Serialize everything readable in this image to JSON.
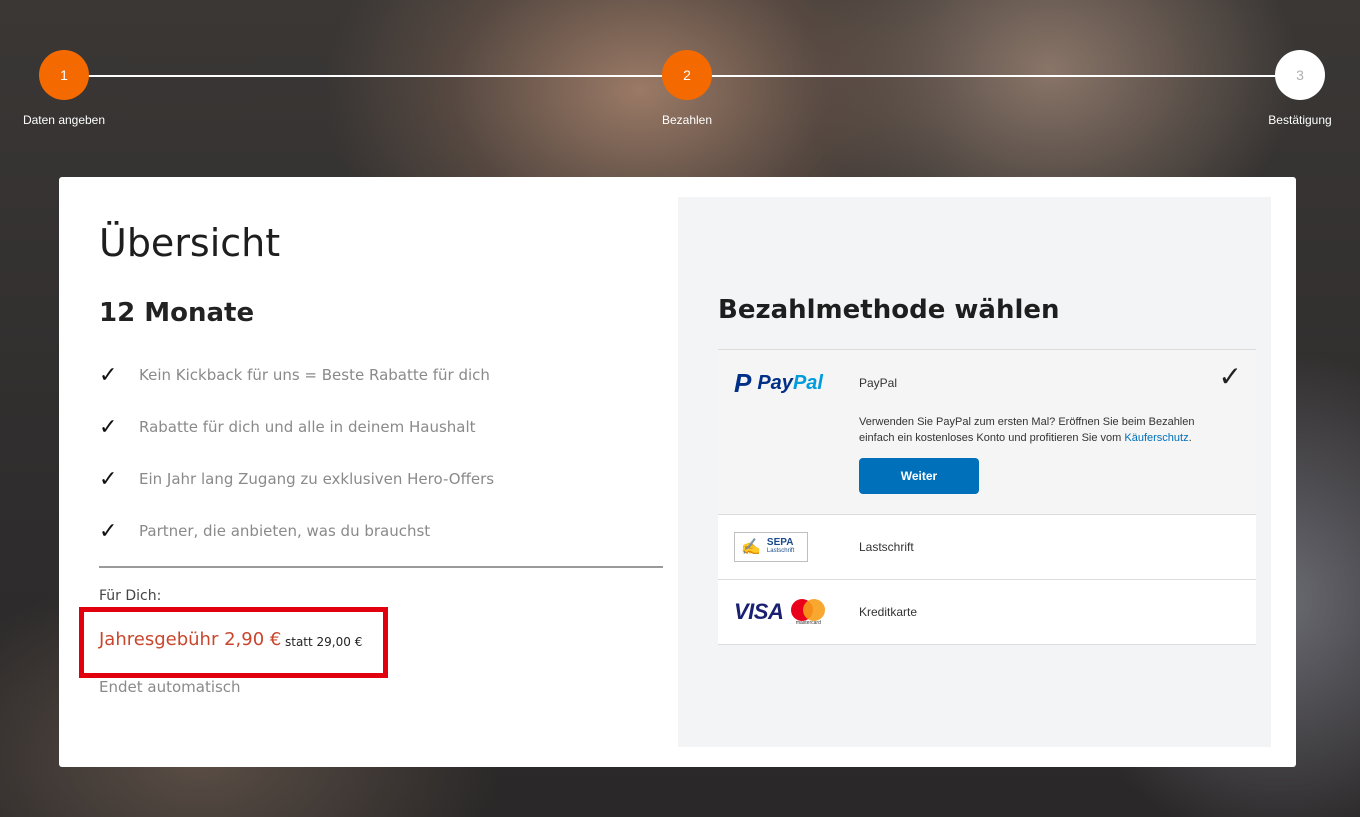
{
  "steps": [
    {
      "number": "1",
      "label": "Daten angeben",
      "state": "done"
    },
    {
      "number": "2",
      "label": "Bezahlen",
      "state": "current"
    },
    {
      "number": "3",
      "label": "Bestätigung",
      "state": "pending"
    }
  ],
  "overview": {
    "title": "Übersicht",
    "plan": "12 Monate",
    "benefits": [
      "Kein Kickback für uns = Beste Rabatte für dich",
      "Rabatte für dich und alle in deinem Haushalt",
      "Ein Jahr lang Zugang zu exklusiven Hero-Offers",
      "Partner, die anbieten, was du brauchst"
    ],
    "for_you_label": "Für Dich:",
    "price": "Jahresgebühr 2,90 €",
    "old_price": "statt 29,00 €",
    "ends": "Endet automatisch"
  },
  "payment": {
    "title": "Bezahlmethode wählen",
    "paypal": {
      "logo_pay": "Pay",
      "logo_pal": "Pal",
      "label": "PayPal",
      "description": "Verwenden Sie PayPal zum ersten Mal? Eröffnen Sie beim Bezahlen einfach ein kostenloses Konto und profitieren Sie vom ",
      "link": "Käuferschutz",
      "description_end": ".",
      "button": "Weiter"
    },
    "sepa": {
      "logo_title": "SEPA",
      "logo_sub": "Lastschrift",
      "label": "Lastschrift"
    },
    "card": {
      "visa": "VISA",
      "mastercard": "mastercard",
      "label": "Kreditkarte"
    }
  },
  "colors": {
    "accent": "#f46a00",
    "price_red": "#c9462c",
    "highlight_box": "#e2000f",
    "paypal_button": "#0070ba"
  }
}
